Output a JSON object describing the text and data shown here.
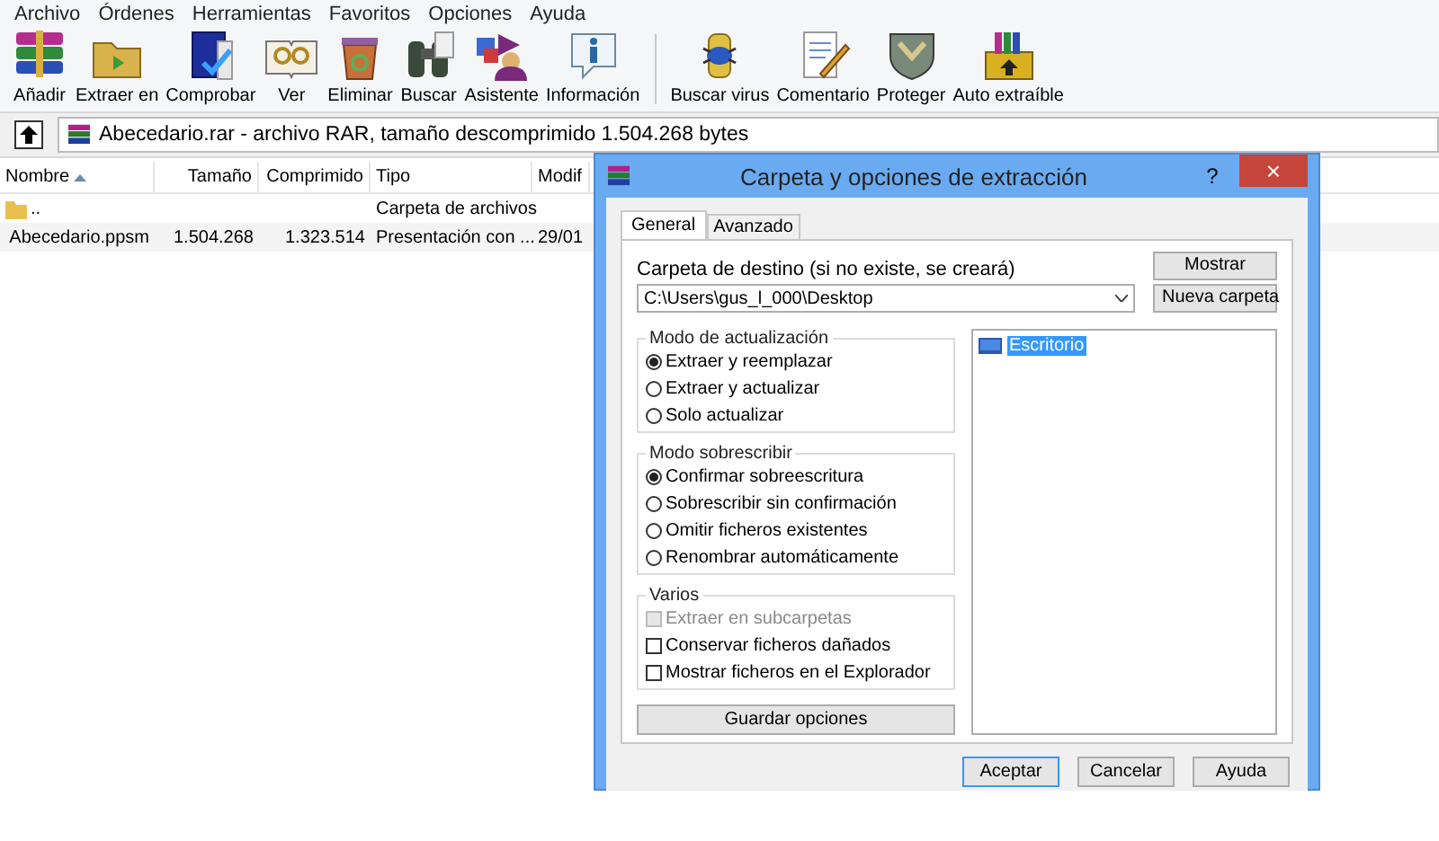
{
  "menu": [
    "Archivo",
    "Órdenes",
    "Herramientas",
    "Favoritos",
    "Opciones",
    "Ayuda"
  ],
  "toolbar": [
    {
      "label": "Añadir",
      "kind": "archive"
    },
    {
      "label": "Extraer en",
      "kind": "extract"
    },
    {
      "label": "Comprobar",
      "kind": "check"
    },
    {
      "label": "Ver",
      "kind": "view"
    },
    {
      "label": "Eliminar",
      "kind": "delete"
    },
    {
      "label": "Buscar",
      "kind": "find"
    },
    {
      "label": "Asistente",
      "kind": "wizard"
    },
    {
      "label": "Información",
      "kind": "info"
    },
    {
      "label": "Buscar virus",
      "kind": "virus",
      "separator_before": true
    },
    {
      "label": "Comentario",
      "kind": "comment"
    },
    {
      "label": "Proteger",
      "kind": "protect"
    },
    {
      "label": "Auto extraíble",
      "kind": "sfx"
    }
  ],
  "address": "Abecedario.rar - archivo RAR, tamaño descomprimido 1.504.268 bytes",
  "file_list": {
    "columns": [
      "Nombre",
      "Tamaño",
      "Comprimido",
      "Tipo",
      "Modif"
    ],
    "rows": [
      {
        "kind": "folder",
        "cells": [
          "..",
          "",
          "",
          "Carpeta de archivos",
          ""
        ]
      },
      {
        "kind": "file",
        "cells": [
          "Abecedario.ppsm",
          "1.504.268",
          "1.323.514",
          "Presentación con ...",
          "29/01"
        ]
      }
    ]
  },
  "dialog": {
    "title": "Carpeta y opciones de extracción",
    "help": "?",
    "close": "×",
    "tabs": [
      {
        "label": "General",
        "selected": true
      },
      {
        "label": "Avanzado",
        "selected": false
      }
    ],
    "destination_label": "Carpeta de destino (si no existe, se creará)",
    "destination": "C:\\Users\\gus_l_000\\Desktop",
    "side_buttons": [
      "Mostrar",
      "Nueva carpeta"
    ],
    "groups": [
      {
        "title": "Modo de actualización",
        "kind": "radio",
        "items": [
          {
            "label": "Extraer y reemplazar",
            "selected": true
          },
          {
            "label": "Extraer y actualizar",
            "selected": false
          },
          {
            "label": "Solo actualizar",
            "selected": false
          }
        ]
      },
      {
        "title": "Modo sobrescribir",
        "kind": "radio",
        "items": [
          {
            "label": "Confirmar sobreescritura",
            "selected": true
          },
          {
            "label": "Sobrescribir sin confirmación",
            "selected": false
          },
          {
            "label": "Omitir ficheros existentes",
            "selected": false
          },
          {
            "label": "Renombrar automáticamente",
            "selected": false
          }
        ]
      },
      {
        "title": "Varios",
        "kind": "check",
        "items": [
          {
            "label": "Extraer en subcarpetas",
            "checked": false,
            "disabled": true
          },
          {
            "label": "Conservar ficheros dañados",
            "checked": false,
            "disabled": false
          },
          {
            "label": "Mostrar ficheros en el Explorador",
            "checked": false,
            "disabled": false
          }
        ]
      }
    ],
    "save_button": "Guardar opciones",
    "tree": [
      {
        "label": "Escritorio",
        "selected": true
      }
    ],
    "buttons": [
      {
        "label": "Aceptar",
        "default": true
      },
      {
        "label": "Cancelar",
        "default": false
      },
      {
        "label": "Ayuda",
        "default": false
      }
    ]
  }
}
